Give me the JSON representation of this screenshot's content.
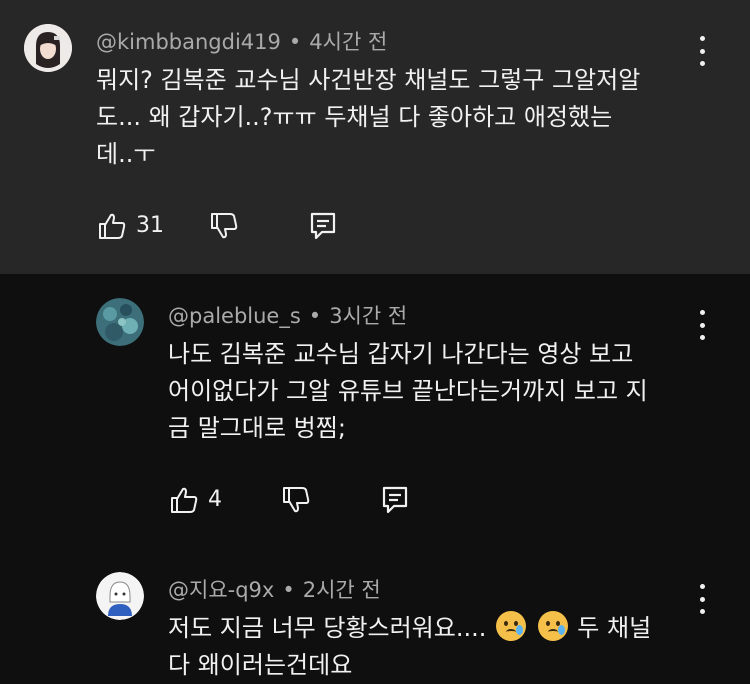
{
  "comments": [
    {
      "username": "@kimbbangdi419",
      "time": "4시간 전",
      "lines": [
        "뭐지? 김복준 교수님 사건반장 채널도 그렇구 그알저알",
        "도... 왜 갑자기..?ㅠㅠ 두채널 다 좋아하고 애정했는",
        "데..ㅜ"
      ],
      "likes": "31"
    },
    {
      "username": "@paleblue_s",
      "time": "3시간 전",
      "lines": [
        "나도 김복준 교수님 갑자기 나간다는 영상 보고",
        "어이없다가 그알 유튜브 끝난다는거까지 보고 지",
        "금 말그대로 벙찜;"
      ],
      "likes": "4"
    },
    {
      "username": "@지요-q9x",
      "time": "2시간 전",
      "line1_text": "저도 지금 너무 당황스러워요....",
      "line1_after": "두 채널",
      "line2": "다 왜이러는건데요"
    }
  ],
  "colors": {
    "top_bg": "#272727",
    "bg": "#0f0f0f",
    "meta": "#aaaaaa",
    "text": "#f1f1f1"
  }
}
